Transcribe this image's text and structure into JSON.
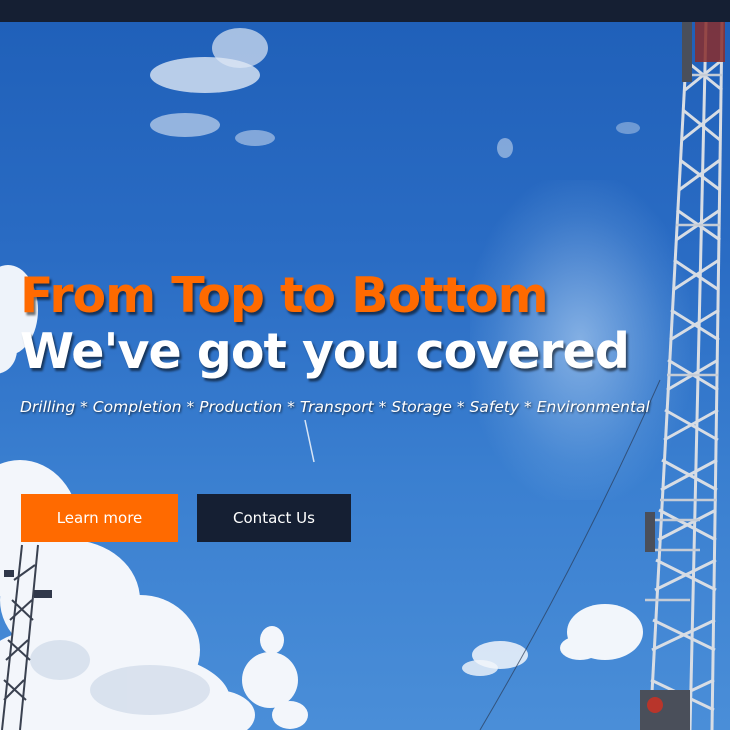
{
  "hero": {
    "headline_line1": "From Top to Bottom",
    "headline_line2": "We've got you covered",
    "services_line": "Drilling * Completion * Production * Transport * Storage * Safety * Environmental"
  },
  "buttons": {
    "learn_more": "Learn more",
    "contact_us": "Contact Us"
  },
  "colors": {
    "accent": "#ff6a00",
    "navy": "#151f33",
    "sky": "#2a6cc4"
  }
}
